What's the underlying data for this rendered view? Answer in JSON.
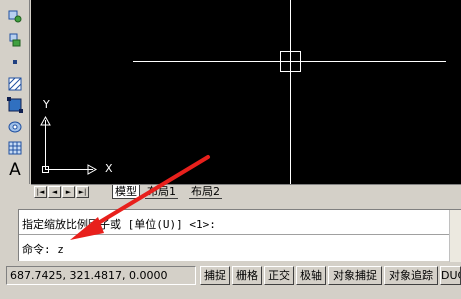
{
  "toolbar": {
    "text_tool_glyph": "A",
    "icons": [
      "insert-block-icon",
      "make-block-icon",
      "point-icon",
      "hatch-icon",
      "gradient-icon",
      "region-icon",
      "table-icon",
      "multiline-text-icon"
    ]
  },
  "viewport": {
    "ucs_x_label": "X",
    "ucs_y_label": "Y",
    "background": "#000000",
    "crosshair_color": "#ffffff"
  },
  "tabs": {
    "nav": [
      "|◄",
      "◄",
      "►",
      "►|"
    ],
    "items": [
      {
        "label": "模型",
        "active": true
      },
      {
        "label": "布局1",
        "active": false
      },
      {
        "label": "布局2",
        "active": false
      }
    ]
  },
  "command": {
    "history_line": "指定缩放比例因子或 [单位(U)] <1>:",
    "prompt": "命令: z"
  },
  "status": {
    "coordinates": "687.7425,  321.4817, 0.0000",
    "buttons": [
      "捕捉",
      "栅格",
      "正交",
      "极轴",
      "对象捕捉",
      "对象追踪",
      "DUCS"
    ]
  },
  "annotation": {
    "arrow_color": "#e8201c"
  }
}
